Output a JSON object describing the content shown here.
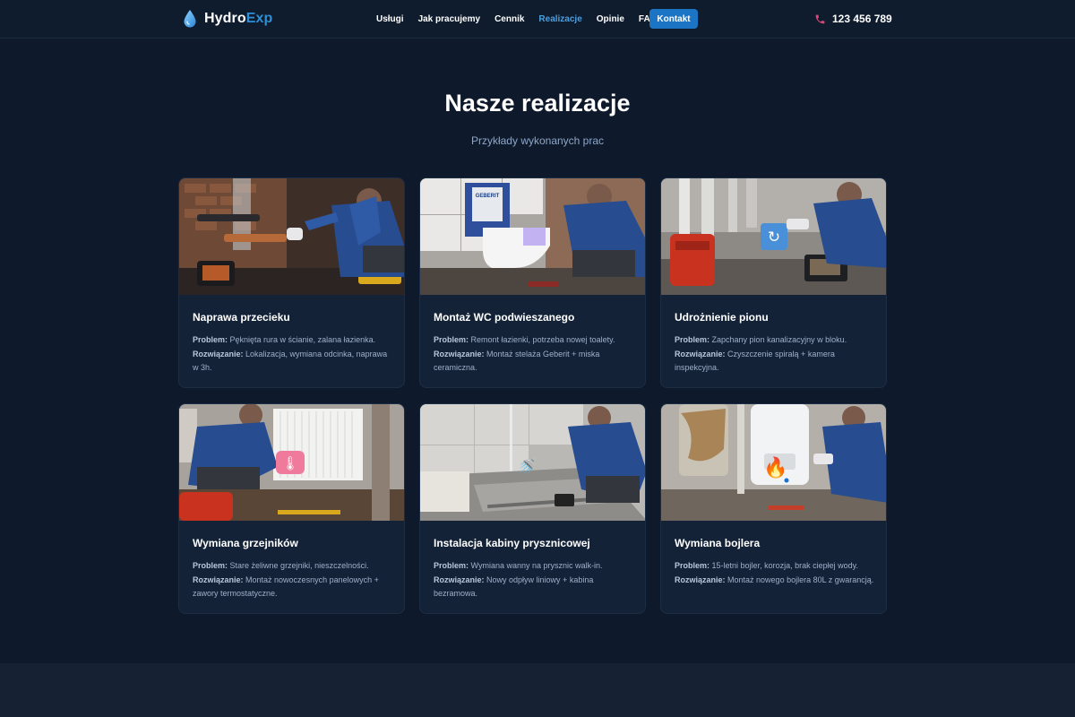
{
  "header": {
    "logo_main": "Hydro",
    "logo_accent": "Exp",
    "nav": [
      {
        "label": "Usługi"
      },
      {
        "label": "Jak pracujemy"
      },
      {
        "label": "Cennik"
      },
      {
        "label": "Realizacje",
        "active": true
      },
      {
        "label": "Opinie"
      },
      {
        "label": "FAQ"
      }
    ],
    "contact_label": "Kontakt",
    "phone": "123 456 789",
    "icons": {
      "logo": "water-drop-icon",
      "phone": "phone-icon"
    }
  },
  "section": {
    "title": "Nasze realizacje",
    "subtitle": "Przykłady wykonanych prac"
  },
  "cards": [
    {
      "title": "Naprawa przecieku",
      "problem_label": "Problem:",
      "problem": "Pęknięta rura w ścianie, zalana łazienka.",
      "solution_label": "Rozwiązanie:",
      "solution": "Lokalizacja, wymiana odcinka, naprawa w 3h."
    },
    {
      "title": "Montaż WC podwieszanego",
      "problem_label": "Problem:",
      "problem": "Remont łazienki, potrzeba nowej toalety.",
      "solution_label": "Rozwiązanie:",
      "solution": "Montaż stelaża Geberit + miska ceramiczna."
    },
    {
      "title": "Udrożnienie pionu",
      "problem_label": "Problem:",
      "problem": "Zapchany pion kanalizacyjny w bloku.",
      "solution_label": "Rozwiązanie:",
      "solution": "Czyszczenie spiralą + kamera inspekcyjna."
    },
    {
      "title": "Wymiana grzejników",
      "problem_label": "Problem:",
      "problem": "Stare żeliwne grzejniki, nieszczelności.",
      "solution_label": "Rozwiązanie:",
      "solution": "Montaż nowoczesnych panelowych + zawory termostatyczne."
    },
    {
      "title": "Instalacja kabiny prysznicowej",
      "problem_label": "Problem:",
      "problem": "Wymiana wanny na prysznic walk-in.",
      "solution_label": "Rozwiązanie:",
      "solution": "Nowy odpływ liniowy + kabina bezramowa."
    },
    {
      "title": "Wymiana bojlera",
      "problem_label": "Problem:",
      "problem": "15-letni bojler, korozja, brak ciepłej wody.",
      "solution_label": "Rozwiązanie:",
      "solution": "Montaż nowego bojlera 80L z gwarancją."
    }
  ],
  "card_images": {
    "brand_label": "GEBERIT",
    "overlay_icons": [
      "refresh-icon",
      "thermometer-icon",
      "shower-icon",
      "flame-icon"
    ]
  },
  "colors": {
    "background": "#0e1a2b",
    "card": "#132237",
    "accent": "#1b74c4",
    "nav_active": "#4a9fe0",
    "phone_icon": "#e0457a"
  }
}
